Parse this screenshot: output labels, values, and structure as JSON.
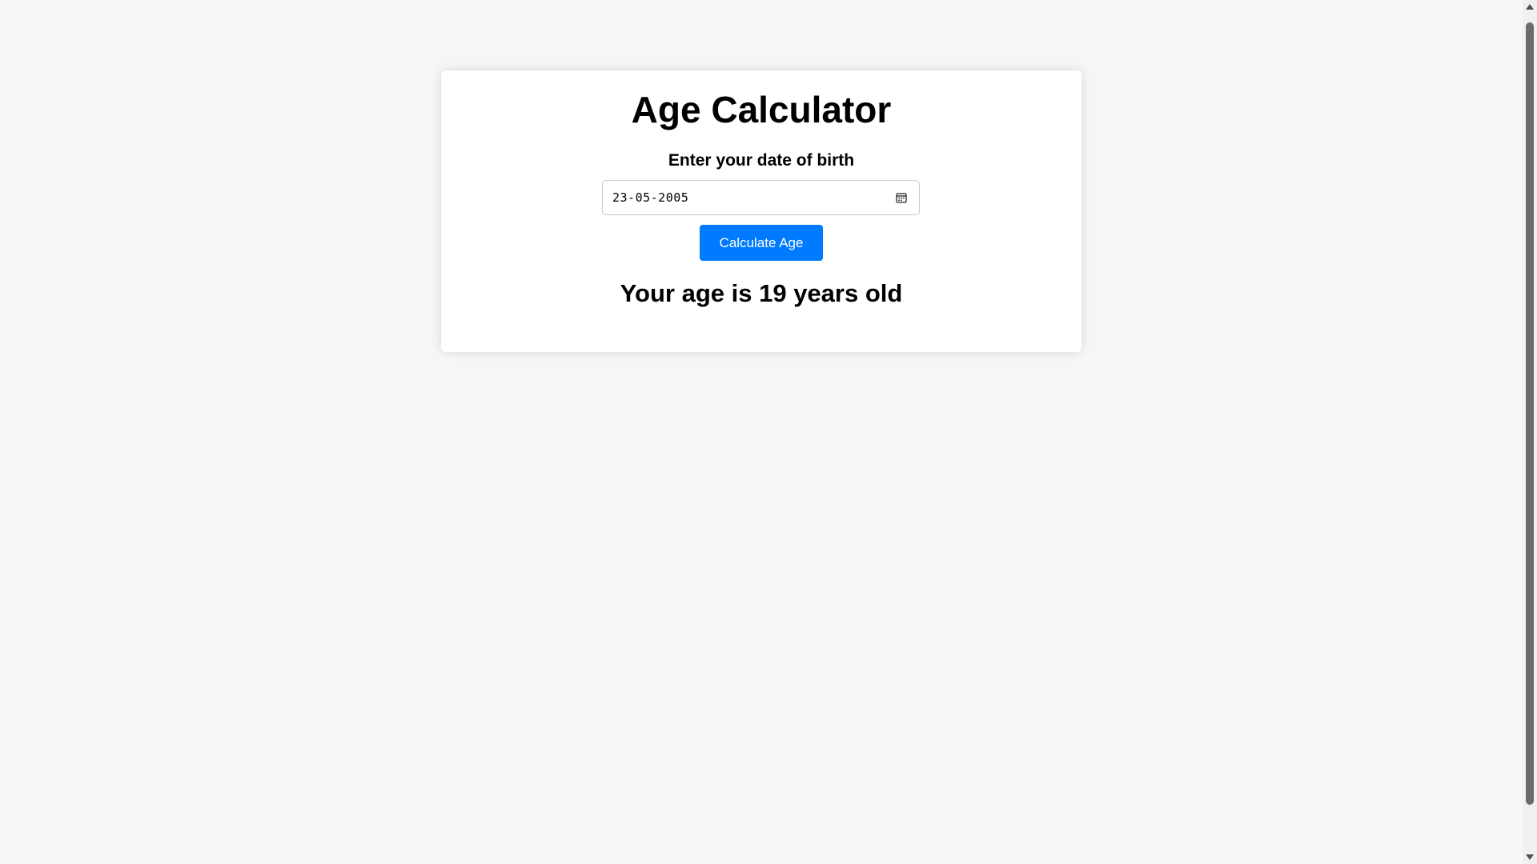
{
  "app": {
    "title": "Age Calculator",
    "prompt": "Enter your date of birth",
    "date_of_birth": {
      "value": "23-05-2005",
      "icon": "calendar-icon"
    },
    "calculate_button": {
      "label": "Calculate Age",
      "color": "#007bff"
    },
    "result": "Your age is 19 years old"
  },
  "colors": {
    "background": "#f6f6f6",
    "card": "#ffffff",
    "accent": "#007bff"
  }
}
